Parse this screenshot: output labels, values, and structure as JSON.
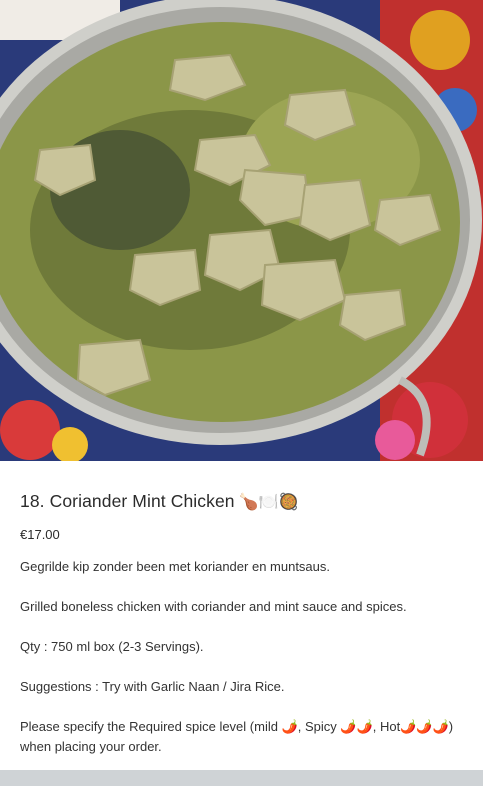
{
  "item": {
    "title": "18. Coriander Mint Chicken",
    "title_emoji": "🍗🍽️🥘",
    "price": "€17.00",
    "description_nl": "Gegrilde kip zonder been met koriander en muntsaus.",
    "description_en": "Grilled boneless chicken with coriander and mint sauce and spices.",
    "quantity": "Qty : 750 ml box (2-3 Servings).",
    "suggestions": "Suggestions : Try with Garlic Naan / Jira Rice.",
    "spice_note": "Please specify the Required spice level (mild 🌶️, Spicy 🌶️🌶️, Hot🌶️🌶️🌶️) when placing your order."
  },
  "colors": {
    "curry_green": "#8f9a4e",
    "pot_steel": "#c9c9c4",
    "cloth_red": "#b3262a",
    "footer_gray": "#cfd3d6"
  }
}
